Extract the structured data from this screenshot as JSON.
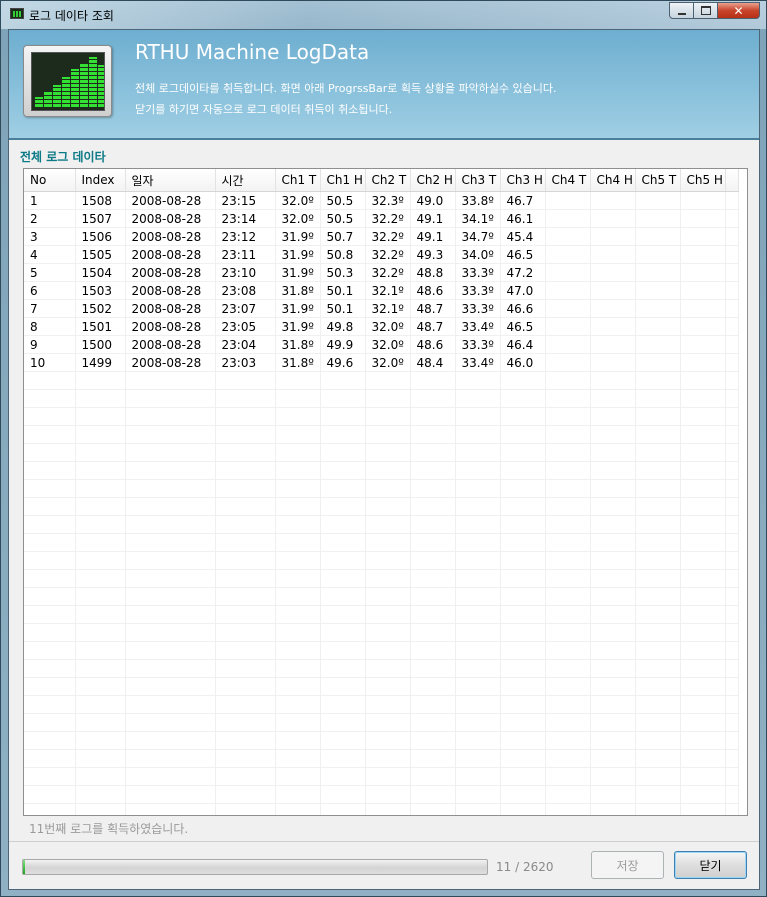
{
  "window": {
    "title": "로그 데이타 조회"
  },
  "header": {
    "title": "RTHU Machine LogData",
    "desc_line1": "전체 로그데이타를 취득합니다. 화면 아래 ProgrssBar로 획득 상황을 파악하실수 있습니다.",
    "desc_line2": "닫기를 하기면 자동으로 로그 데이터 취득이 취소됩니다."
  },
  "section_label": "전체 로그 데이타",
  "grid": {
    "columns": [
      "No",
      "Index",
      "일자",
      "시간",
      "Ch1 T",
      "Ch1 H",
      "Ch2 T",
      "Ch2 H",
      "Ch3 T",
      "Ch3 H",
      "Ch4 T",
      "Ch4 H",
      "Ch5 T",
      "Ch5 H"
    ],
    "rows": [
      [
        "1",
        "1508",
        "2008-08-28",
        "23:15",
        "32.0º",
        "50.5",
        "32.3º",
        "49.0",
        "33.8º",
        "46.7",
        "",
        "",
        "",
        ""
      ],
      [
        "2",
        "1507",
        "2008-08-28",
        "23:14",
        "32.0º",
        "50.5",
        "32.2º",
        "49.1",
        "34.1º",
        "46.1",
        "",
        "",
        "",
        ""
      ],
      [
        "3",
        "1506",
        "2008-08-28",
        "23:12",
        "31.9º",
        "50.7",
        "32.2º",
        "49.1",
        "34.7º",
        "45.4",
        "",
        "",
        "",
        ""
      ],
      [
        "4",
        "1505",
        "2008-08-28",
        "23:11",
        "31.9º",
        "50.8",
        "32.2º",
        "49.3",
        "34.0º",
        "46.5",
        "",
        "",
        "",
        ""
      ],
      [
        "5",
        "1504",
        "2008-08-28",
        "23:10",
        "31.9º",
        "50.3",
        "32.2º",
        "48.8",
        "33.3º",
        "47.2",
        "",
        "",
        "",
        ""
      ],
      [
        "6",
        "1503",
        "2008-08-28",
        "23:08",
        "31.8º",
        "50.1",
        "32.1º",
        "48.6",
        "33.3º",
        "47.0",
        "",
        "",
        "",
        ""
      ],
      [
        "7",
        "1502",
        "2008-08-28",
        "23:07",
        "31.9º",
        "50.1",
        "32.1º",
        "48.7",
        "33.3º",
        "46.6",
        "",
        "",
        "",
        ""
      ],
      [
        "8",
        "1501",
        "2008-08-28",
        "23:05",
        "31.9º",
        "49.8",
        "32.0º",
        "48.7",
        "33.4º",
        "46.5",
        "",
        "",
        "",
        ""
      ],
      [
        "9",
        "1500",
        "2008-08-28",
        "23:04",
        "31.8º",
        "49.9",
        "32.0º",
        "48.6",
        "33.3º",
        "46.4",
        "",
        "",
        "",
        ""
      ],
      [
        "10",
        "1499",
        "2008-08-28",
        "23:03",
        "31.8º",
        "49.6",
        "32.0º",
        "48.4",
        "33.4º",
        "46.0",
        "",
        "",
        "",
        ""
      ]
    ]
  },
  "status": "11번째 로그를 획득하였습니다.",
  "progress": {
    "current": 11,
    "total": 2620,
    "fraction": 0.0042,
    "text": "11 / 2620"
  },
  "buttons": {
    "save": "저장",
    "close": "닫기"
  }
}
